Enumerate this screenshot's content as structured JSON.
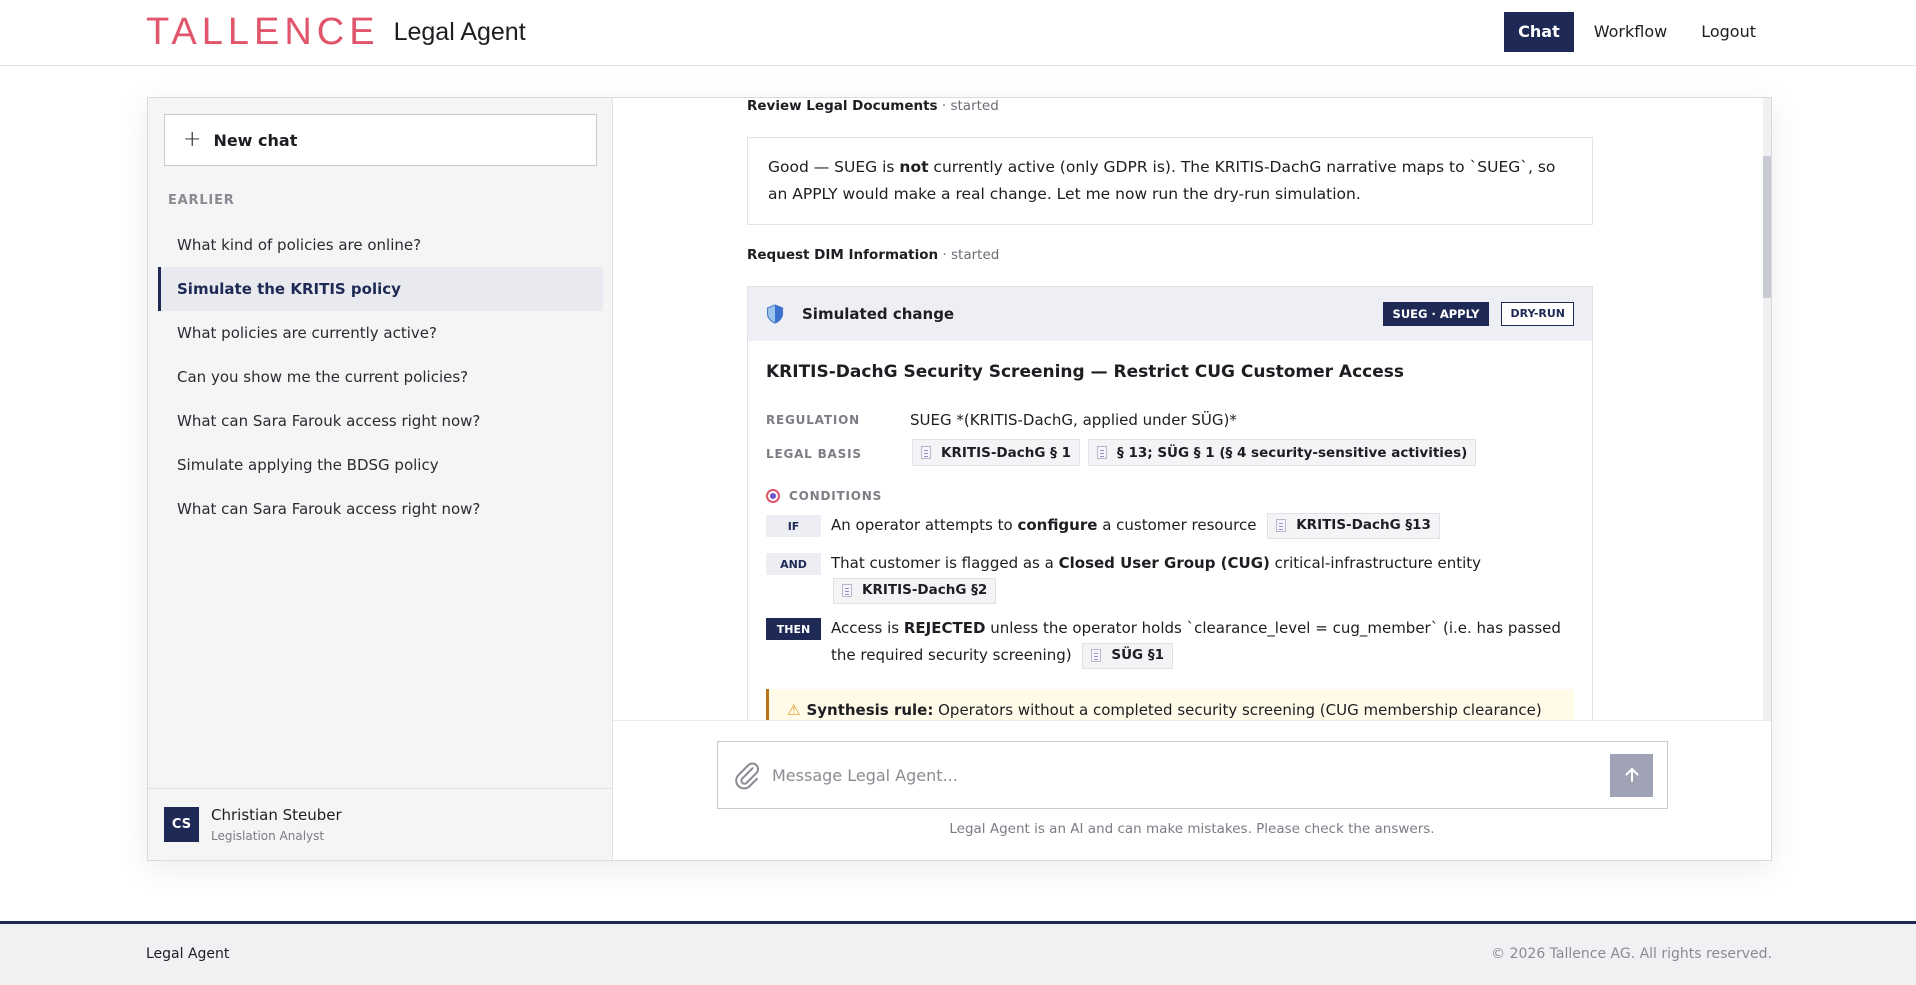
{
  "header": {
    "logo_text": "TALLENCE",
    "app_name": "Legal Agent",
    "nav": [
      {
        "label": "Chat",
        "active": true
      },
      {
        "label": "Workflow",
        "active": false
      },
      {
        "label": "Logout",
        "active": false
      }
    ]
  },
  "sidebar": {
    "new_chat_label": "New chat",
    "section_label": "EARLIER",
    "history": [
      {
        "label": "What kind of policies are online?",
        "active": false
      },
      {
        "label": "Simulate the KRITIS policy",
        "active": true
      },
      {
        "label": "What policies are currently active?",
        "active": false
      },
      {
        "label": "Can you show me the current policies?",
        "active": false
      },
      {
        "label": "What can Sara Farouk access right now?",
        "active": false
      },
      {
        "label": "Simulate applying the BDSG policy",
        "active": false
      },
      {
        "label": "What can Sara Farouk access right now?",
        "active": false
      }
    ],
    "user": {
      "initials": "CS",
      "name": "Christian Steuber",
      "role": "Legislation Analyst"
    }
  },
  "chat": {
    "step1": {
      "name": "Review Legal Documents",
      "status": "· started"
    },
    "message": {
      "p1": "Good — SUEG is ",
      "p_bold": "not",
      "p2": " currently active (only GDPR is). The KRITIS-DachG narrative maps to `SUEG`, so an APPLY would make a real change. Let me now run the dry-run simulation."
    },
    "step2": {
      "name": "Request DIM Information",
      "status": "· started"
    },
    "simulation": {
      "header_title": "Simulated change",
      "tag_action": "SUEG · APPLY",
      "tag_mode": "DRY-RUN",
      "title": "KRITIS-DachG Security Screening — Restrict CUG Customer Access",
      "regulation_label": "REGULATION",
      "regulation_value": "SUEG *(KRITIS-DachG, applied under SÜG)*",
      "legal_basis_label": "LEGAL BASIS",
      "legal_basis": [
        "KRITIS-DachG § 1",
        "§ 13; SÜG § 1 (§ 4 security-sensitive activities)"
      ],
      "conditions_label": "CONDITIONS",
      "conditions": {
        "if": {
          "keyword": "IF",
          "t1": "An operator attempts to ",
          "b1": "configure",
          "t2": " a customer resource",
          "chip": "KRITIS-DachG §13"
        },
        "and": {
          "keyword": "AND",
          "t1": "That customer is flagged as a ",
          "b1": "Closed User Group (CUG)",
          "t2": " critical-infrastructure entity",
          "chip": "KRITIS-DachG §2"
        },
        "then": {
          "keyword": "THEN",
          "t1": "Access is ",
          "b1": "REJECTED",
          "t2": " unless the operator holds `clearance_level = cug_member` (i.e. has passed the required security screening)",
          "chip": "SÜG §1"
        }
      },
      "synthesis_label": "Synthesis rule:",
      "synthesis_text": " Operators without a completed security screening (CUG membership clearance) are"
    },
    "composer": {
      "placeholder": "Message Legal Agent...",
      "disclaimer": "Legal Agent is an AI and can make mistakes. Please check the answers."
    }
  },
  "footer": {
    "left": "Legal Agent",
    "right": "© 2026 Tallence AG. All rights reserved."
  },
  "colors": {
    "brand": "#e0556a",
    "navy": "#1e2a55",
    "warning_border": "#b5761a"
  },
  "icons": [
    "plus-icon",
    "shield-icon",
    "document-icon",
    "target-icon",
    "warning-icon",
    "paperclip-icon",
    "arrow-up-icon"
  ]
}
